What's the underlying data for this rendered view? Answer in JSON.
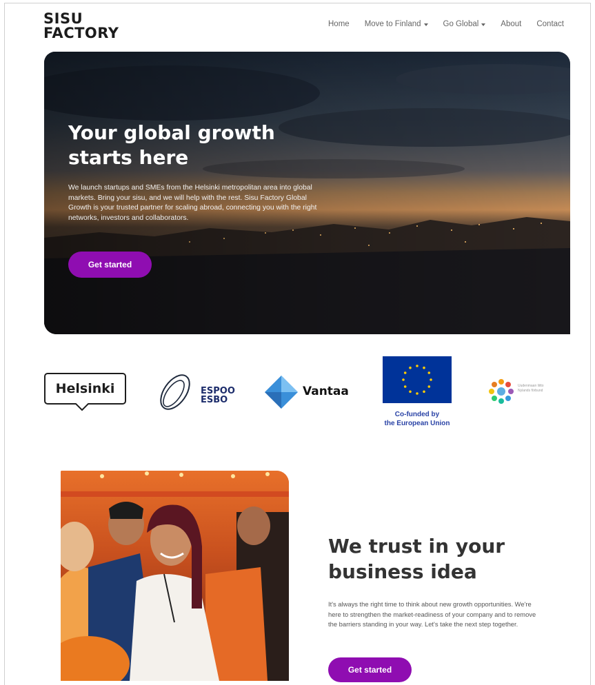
{
  "header": {
    "logo_line1": "SISU",
    "logo_line2": "FACTORY",
    "nav": [
      {
        "label": "Home"
      },
      {
        "label": "Move to Finland"
      },
      {
        "label": "Go Global"
      },
      {
        "label": "About"
      },
      {
        "label": "Contact"
      }
    ]
  },
  "hero": {
    "title": "Your global growth starts here",
    "text": "We launch startups and SMEs from the Helsinki metropolitan area into global markets. Bring your sisu, and we will help with the rest. Sisu Factory Global Growth is your trusted partner for scaling abroad, connecting you with the right networks, investors and collaborators.",
    "button": "Get started"
  },
  "partners": {
    "helsinki": "Helsinki",
    "espoo_line1": "ESPOO",
    "espoo_line2": "ESBO",
    "vantaa": "Vantaa",
    "eu_caption_line1": "Co-funded by",
    "eu_caption_line2": "the European Union",
    "uusimaa_line1": "Uudenmaan liitto",
    "uusimaa_line2": "Nylands förbund"
  },
  "trust": {
    "title": "We trust in your business idea",
    "text": "It's always the right time to think about new growth opportunities. We're here to strengthen the market-readiness of your company and to remove the barriers standing in your way. Let's take the next step together.",
    "button": "Get started"
  },
  "colors": {
    "accent": "#8f0db1",
    "eu_blue": "#003399",
    "eu_gold": "#ffcc00",
    "espoo_navy": "#1c2c6b",
    "vantaa_blue": "#3a8fd9"
  }
}
